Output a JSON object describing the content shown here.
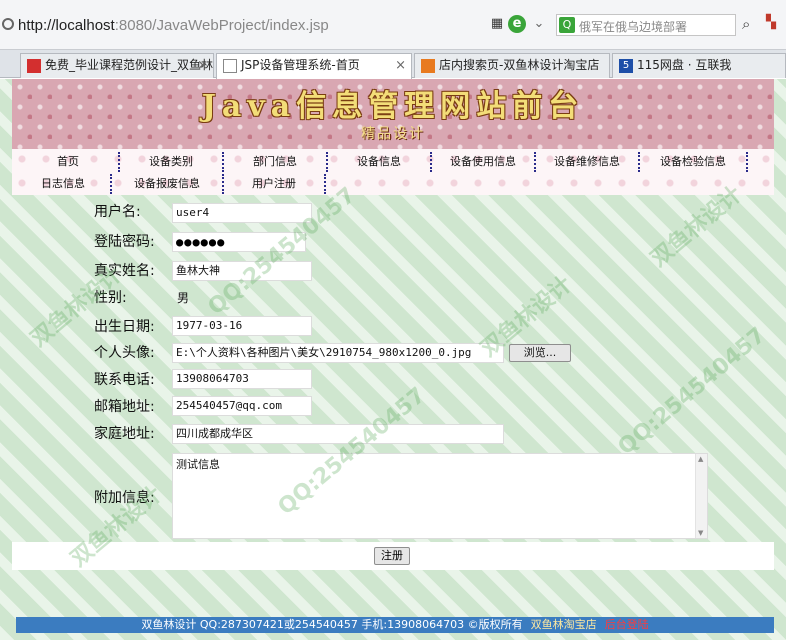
{
  "browser": {
    "url_host": "http://localhost",
    "url_rest": ":8080/JavaWebProject/index.jsp",
    "search_placeholder": "俄军在俄乌边境部署",
    "tabs": [
      {
        "label": "免费_毕业课程范例设计_双鱼林",
        "icon": "red-square-icon"
      },
      {
        "label": "JSP设备管理系统-首页",
        "icon": "page-icon"
      },
      {
        "label": "店内搜索页-双鱼林设计淘宝店",
        "icon": "taobao-icon"
      },
      {
        "label": "115网盘 · 互联我",
        "icon": "115-icon"
      }
    ]
  },
  "banner": {
    "title": "Java信息管理网站前台",
    "subtitle": "精品设计"
  },
  "nav": {
    "row1": [
      "首页",
      "设备类别",
      "部门信息",
      "设备信息",
      "设备使用信息",
      "设备维修信息",
      "设备检验信息"
    ],
    "row2": [
      "日志信息",
      "设备报废信息",
      "用户注册"
    ]
  },
  "form": {
    "username_label": "用户名:",
    "username_value": "user4",
    "password_label": "登陆密码:",
    "password_value": "●●●●●●",
    "realname_label": "真实姓名:",
    "realname_value": "鱼林大神",
    "gender_label": "性别:",
    "gender_value": "男",
    "birthday_label": "出生日期:",
    "birthday_value": "1977-03-16",
    "avatar_label": "个人头像:",
    "avatar_value": "E:\\个人资料\\各种图片\\美女\\2910754_980x1200_0.jpg",
    "browse_label": "浏览...",
    "phone_label": "联系电话:",
    "phone_value": "13908064703",
    "email_label": "邮箱地址:",
    "email_value": "254540457@qq.com",
    "address_label": "家庭地址:",
    "address_value": "四川成都成华区",
    "extra_label": "附加信息:",
    "extra_value": "测试信息",
    "submit_label": "注册"
  },
  "footer": {
    "text": "双鱼林设计 QQ:287307421或254540457 手机:13908064703 ©版权所有",
    "shop_link": "双鱼林淘宝店",
    "admin_link": "后台登陆"
  },
  "watermarks": [
    "双鱼林设计",
    "QQ:254540457"
  ]
}
